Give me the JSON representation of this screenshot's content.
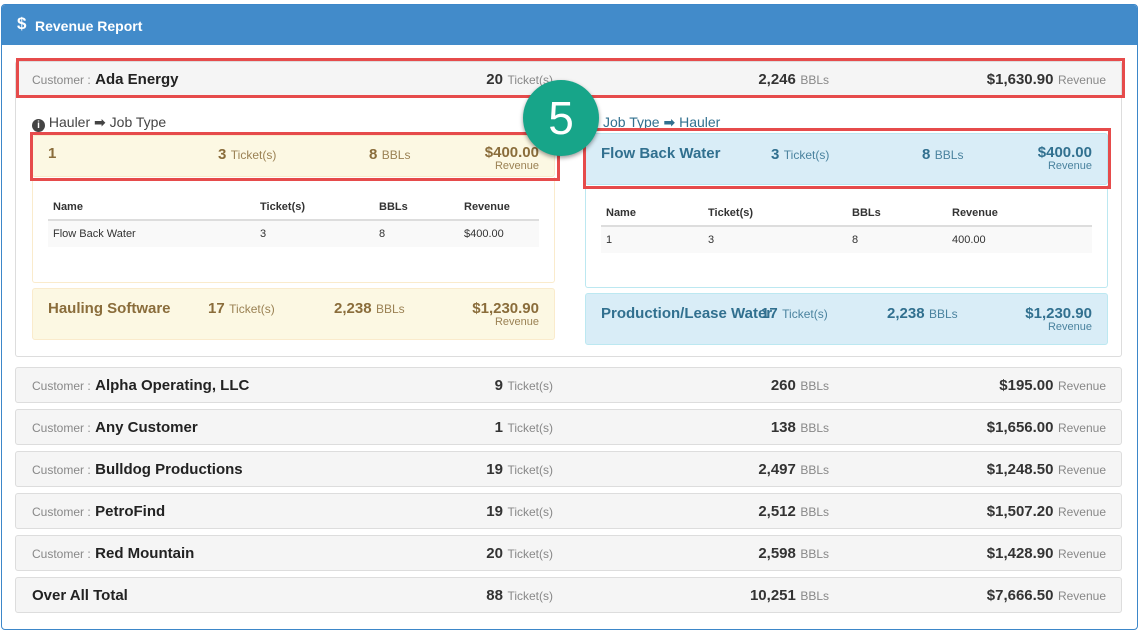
{
  "header": {
    "icon": "dollar-icon",
    "title": "Revenue Report"
  },
  "labels": {
    "customer_prefix": "Customer :",
    "tickets": "Ticket(s)",
    "bbls": "BBLs",
    "revenue": "Revenue"
  },
  "expanded": {
    "customer": "Ada Energy",
    "tickets": "20",
    "bbls": "2,246",
    "revenue": "$1,630.90",
    "left_title": "Hauler",
    "left_title2": "Job Type",
    "right_title": "Job Type",
    "right_title2": "Hauler",
    "left_cards": [
      {
        "name": "1",
        "tickets": "3",
        "bbls": "8",
        "revenue": "$400.00"
      },
      {
        "name": "Hauling Software",
        "tickets": "17",
        "bbls": "2,238",
        "revenue": "$1,230.90"
      }
    ],
    "right_cards": [
      {
        "name": "Flow Back Water",
        "tickets": "3",
        "bbls": "8",
        "revenue": "$400.00"
      },
      {
        "name": "Production/Lease Water",
        "tickets": "17",
        "bbls": "2,238",
        "revenue": "$1,230.90"
      }
    ],
    "left_table": {
      "headers": [
        "Name",
        "Ticket(s)",
        "BBLs",
        "Revenue"
      ],
      "row": [
        "Flow Back Water",
        "3",
        "8",
        "$400.00"
      ]
    },
    "right_table": {
      "headers": [
        "Name",
        "Ticket(s)",
        "BBLs",
        "Revenue"
      ],
      "row": [
        "1",
        "3",
        "8",
        "400.00"
      ]
    }
  },
  "customers": [
    {
      "name": "Alpha Operating, LLC",
      "tickets": "9",
      "bbls": "260",
      "revenue": "$195.00"
    },
    {
      "name": "Any Customer",
      "tickets": "1",
      "bbls": "138",
      "revenue": "$1,656.00"
    },
    {
      "name": "Bulldog Productions",
      "tickets": "19",
      "bbls": "2,497",
      "revenue": "$1,248.50"
    },
    {
      "name": "PetroFind",
      "tickets": "19",
      "bbls": "2,512",
      "revenue": "$1,507.20"
    },
    {
      "name": "Red Mountain",
      "tickets": "20",
      "bbls": "2,598",
      "revenue": "$1,428.90"
    }
  ],
  "total": {
    "label": "Over All Total",
    "tickets": "88",
    "bbls": "10,251",
    "revenue": "$7,666.50"
  },
  "step_badge": "5",
  "colors": {
    "header": "#428bca",
    "badge": "#17a589",
    "highlight": "#e64b4b"
  }
}
